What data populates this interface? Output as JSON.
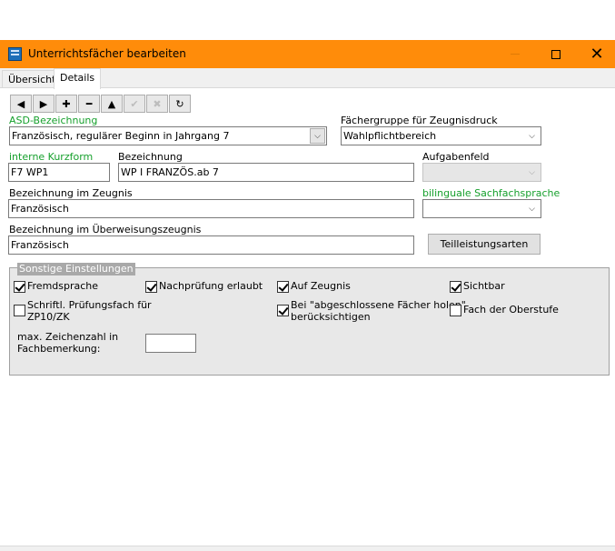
{
  "window": {
    "title": "Unterrichtsfächer bearbeiten",
    "controls": {
      "minimize": "—",
      "maximize": "☐",
      "close": "✕"
    }
  },
  "tabs": [
    {
      "label": "Übersicht",
      "active": false
    },
    {
      "label": "Details",
      "active": true
    }
  ],
  "toolbar": {
    "buttons": [
      {
        "icon": "previous-icon",
        "glyph": "◀",
        "enabled": true
      },
      {
        "icon": "next-icon",
        "glyph": "▶",
        "enabled": true
      },
      {
        "icon": "add-icon",
        "glyph": "✚",
        "enabled": true
      },
      {
        "icon": "delete-icon",
        "glyph": "━",
        "enabled": true
      },
      {
        "icon": "up-icon",
        "glyph": "▲",
        "enabled": true
      },
      {
        "icon": "confirm-icon",
        "glyph": "✔",
        "enabled": false
      },
      {
        "icon": "cancel-icon",
        "glyph": "✖",
        "enabled": false
      },
      {
        "icon": "refresh-icon",
        "glyph": "↻",
        "enabled": true
      }
    ]
  },
  "form": {
    "asd": {
      "label": "ASD-Bezeichnung",
      "value": "Französisch, regulärer Beginn in Jahrgang 7"
    },
    "faechergruppe": {
      "label": "Fächergruppe für Zeugnisdruck",
      "value": "Wahlpflichtbereich"
    },
    "kurzform": {
      "label": "interne Kurzform",
      "value": "F7 WP1"
    },
    "bezeichnung": {
      "label": "Bezeichnung",
      "value": "WP I FRANZÖS.ab 7"
    },
    "aufgabenfeld": {
      "label": "Aufgabenfeld",
      "value": ""
    },
    "zeugnis": {
      "label": "Bezeichnung im Zeugnis",
      "value": "Französisch"
    },
    "bilingual": {
      "label": "bilinguale Sachfachsprache",
      "value": ""
    },
    "ueberweisung": {
      "label": "Bezeichnung im Überweisungszeugnis",
      "value": "Französisch"
    },
    "teilleistung_button": "Teilleistungsarten"
  },
  "settings": {
    "title": "Sonstige Einstellungen",
    "checkboxes": {
      "fremdsprache": {
        "label": "Fremdsprache",
        "checked": true
      },
      "nachpruefung": {
        "label": "Nachprüfung erlaubt",
        "checked": true
      },
      "aufzeugnis": {
        "label": "Auf Zeugnis",
        "checked": true
      },
      "sichtbar": {
        "label": "Sichtbar",
        "checked": true
      },
      "pruefungsfach": {
        "label_line1": "Schriftl. Prüfungsfach für",
        "label_line2": "ZP10/ZK",
        "checked": false
      },
      "abgeschlossen": {
        "label_line1": "Bei \"abgeschlossene Fächer holen\"",
        "label_line2": "berücksichtigen",
        "checked": true
      },
      "oberstufe": {
        "label": "Fach der Oberstufe",
        "checked": false
      }
    },
    "max_zeichen": {
      "label_line1": "max. Zeichenzahl in",
      "label_line2": "Fachbemerkung:",
      "value": ""
    }
  },
  "colors": {
    "titlebar": "#ff8c0a",
    "green_label": "#16a02c"
  }
}
